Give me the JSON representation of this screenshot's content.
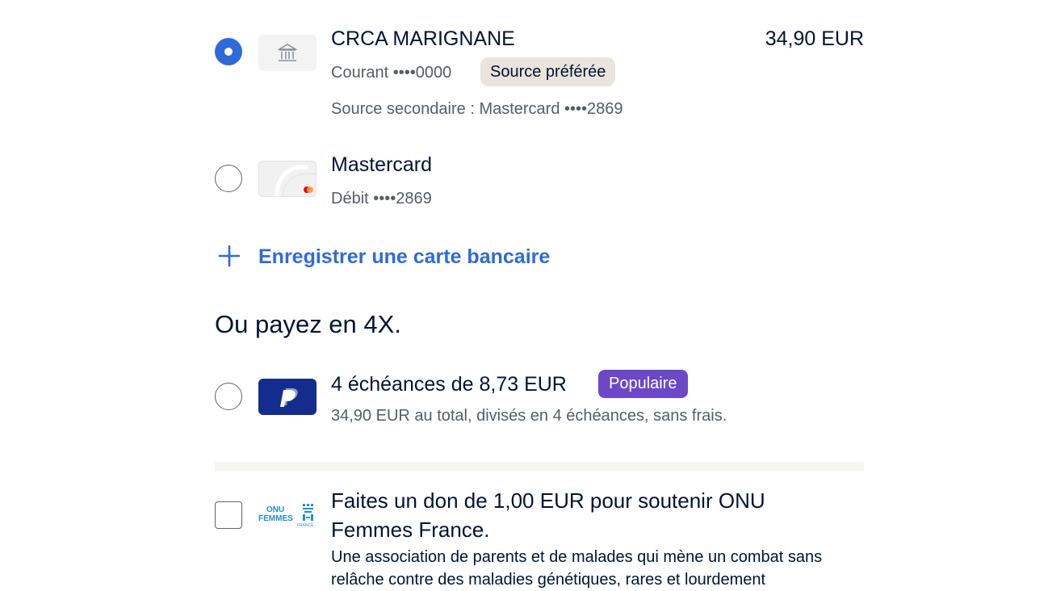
{
  "payment_sources": [
    {
      "name": "CRCA MARIGNANE",
      "detail": "Courant ••••0000",
      "badge": "Source préférée",
      "secondary": "Source secondaire : Mastercard ••••2869",
      "amount": "34,90 EUR",
      "selected": true,
      "icon": "bank-icon"
    },
    {
      "name": "Mastercard",
      "detail": "Débit ••••2869",
      "selected": false,
      "icon": "mastercard-icon"
    }
  ],
  "add_card": {
    "icon": "plus-icon",
    "label": "Enregistrer une carte bancaire"
  },
  "pay_in_4": {
    "heading": "Ou payez en 4X.",
    "option_title": "4 échéances de 8,73 EUR",
    "badge": "Populaire",
    "option_detail": "34,90 EUR au total, divisés en 4 échéances, sans frais.",
    "icon": "paypal-icon",
    "selected": false
  },
  "donation": {
    "title": "Faites un don de 1,00 EUR pour soutenir ONU Femmes France.",
    "description": "Une association de parents et de malades qui mène un combat sans relâche contre des maladies génétiques, rares et lourdement",
    "logo_text": "ONU FEMMES FRANCE",
    "checked": false
  },
  "colors": {
    "accent": "#2f6bd8",
    "text": "#001435",
    "muted": "#545d68",
    "badge_preferred": "#e9e4dc",
    "badge_popular": "#6b48c8",
    "paypal": "#142c8e"
  }
}
